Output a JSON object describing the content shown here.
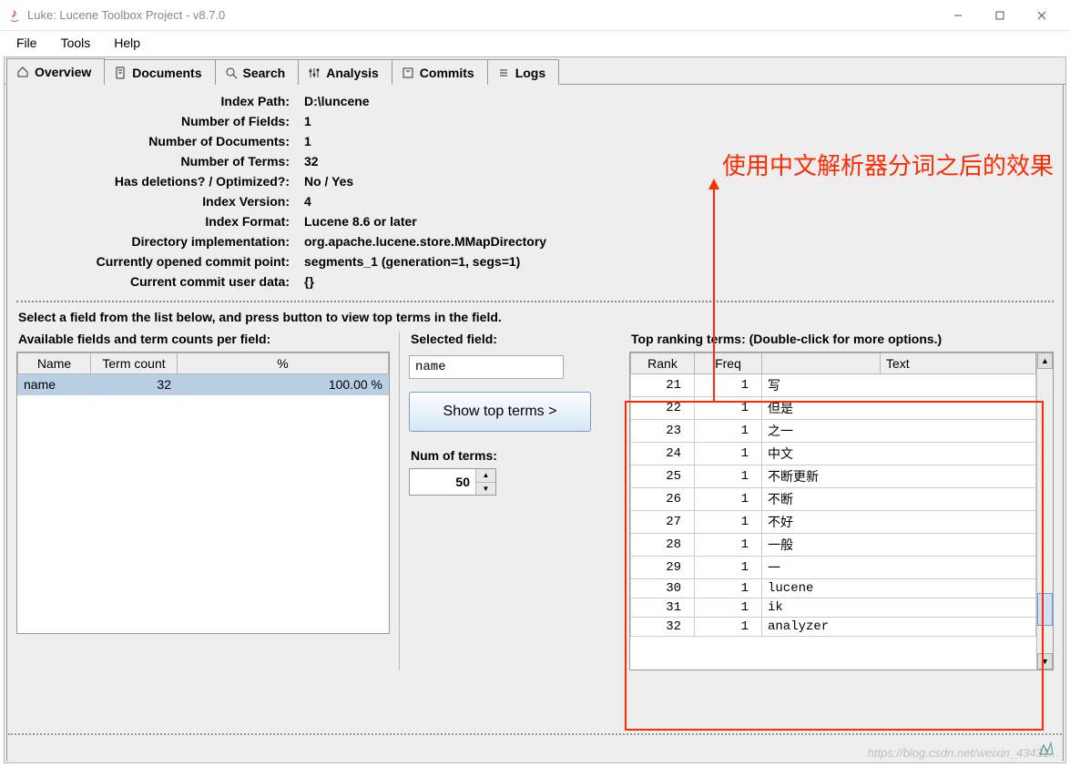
{
  "window": {
    "title": "Luke: Lucene Toolbox Project - v8.7.0"
  },
  "menu": {
    "items": [
      "File",
      "Tools",
      "Help"
    ]
  },
  "tabs": [
    {
      "name": "overview",
      "label": "Overview",
      "icon": "home-icon",
      "active": true
    },
    {
      "name": "documents",
      "label": "Documents",
      "icon": "doc-icon"
    },
    {
      "name": "search",
      "label": "Search",
      "icon": "search-icon"
    },
    {
      "name": "analysis",
      "label": "Analysis",
      "icon": "sliders-icon"
    },
    {
      "name": "commits",
      "label": "Commits",
      "icon": "commit-icon"
    },
    {
      "name": "logs",
      "label": "Logs",
      "icon": "list-icon"
    }
  ],
  "info": {
    "index_path": {
      "label": "Index Path:",
      "value": "D:\\luncene"
    },
    "num_fields": {
      "label": "Number of Fields:",
      "value": "1"
    },
    "num_docs": {
      "label": "Number of Documents:",
      "value": "1"
    },
    "num_terms": {
      "label": "Number of Terms:",
      "value": "32"
    },
    "deletions": {
      "label": "Has deletions? / Optimized?:",
      "value": "No / Yes"
    },
    "version": {
      "label": "Index Version:",
      "value": "4"
    },
    "format": {
      "label": "Index Format:",
      "value": "Lucene 8.6 or later"
    },
    "dir_impl": {
      "label": "Directory implementation:",
      "value": "org.apache.lucene.store.MMapDirectory"
    },
    "commit_point": {
      "label": "Currently opened commit point:",
      "value": "segments_1 (generation=1, segs=1)"
    },
    "commit_user": {
      "label": "Current commit user data:",
      "value": "{}"
    }
  },
  "instructions": "Select a field from the list below, and press button to view top terms in the field.",
  "fields_section": {
    "heading": "Available fields and term counts per field:",
    "columns": [
      "Name",
      "Term count",
      "%"
    ],
    "rows": [
      {
        "name": "name",
        "count": "32",
        "pct": "100.00 %"
      }
    ]
  },
  "mid": {
    "selected_label": "Selected field:",
    "selected_value": "name",
    "show_btn": "Show top terms >",
    "num_label": "Num of terms:",
    "num_value": "50"
  },
  "terms_section": {
    "heading": "Top ranking terms: (Double-click for more options.)",
    "columns": {
      "rank": "Rank",
      "freq": "Freq",
      "spacer": "",
      "text": "Text"
    },
    "rows": [
      {
        "rank": "21",
        "freq": "1",
        "text": "写"
      },
      {
        "rank": "22",
        "freq": "1",
        "text": "但是"
      },
      {
        "rank": "23",
        "freq": "1",
        "text": "之一"
      },
      {
        "rank": "24",
        "freq": "1",
        "text": "中文"
      },
      {
        "rank": "25",
        "freq": "1",
        "text": "不断更新"
      },
      {
        "rank": "26",
        "freq": "1",
        "text": "不断"
      },
      {
        "rank": "27",
        "freq": "1",
        "text": "不好"
      },
      {
        "rank": "28",
        "freq": "1",
        "text": "一般"
      },
      {
        "rank": "29",
        "freq": "1",
        "text": "一"
      },
      {
        "rank": "30",
        "freq": "1",
        "text": "lucene"
      },
      {
        "rank": "31",
        "freq": "1",
        "text": "ik"
      },
      {
        "rank": "32",
        "freq": "1",
        "text": "analyzer"
      }
    ]
  },
  "annotation": "使用中文解析器分词之后的效果",
  "watermark": "https://blog.csdn.net/weixin_43431..."
}
